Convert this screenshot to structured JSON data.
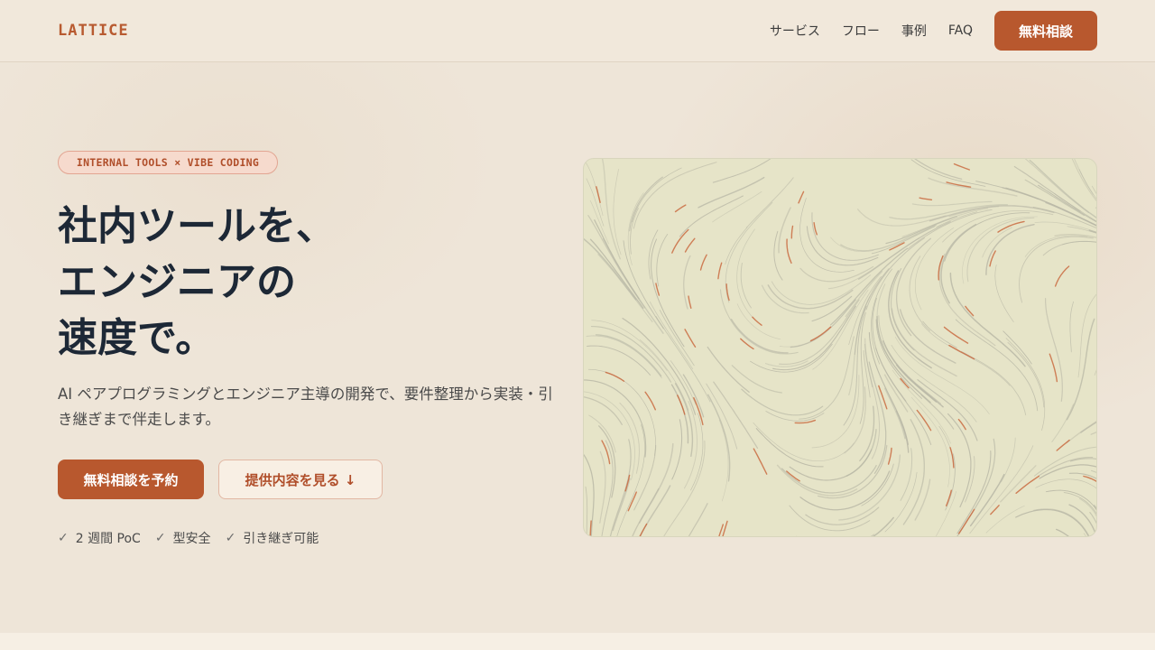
{
  "brand": {
    "logo": "LATTICE"
  },
  "nav": {
    "items": [
      "サービス",
      "フロー",
      "事例",
      "FAQ"
    ],
    "cta": "無料相談"
  },
  "hero": {
    "badge": "INTERNAL TOOLS × VIBE CODING",
    "title_lines": [
      "社内ツールを、",
      "エンジニアの",
      "速度で。"
    ],
    "subtitle": "AI ペアプログラミングとエンジニア主導の開発で、要件整理から実装・引き継ぎまで伴走します。",
    "primary_cta": "無料相談を予約",
    "secondary_cta": "提供内容を見る ↓",
    "checks": [
      "2 週間 PoC",
      "型安全",
      "引き継ぎ可能"
    ]
  },
  "colors": {
    "accent": "#b8582e",
    "background": "#efe6da",
    "visual_bg": "#e6e4c8",
    "stroke_gray": "#b9b8a6",
    "stroke_orange": "#c8643a"
  },
  "visual": {
    "icon": "flow-field-lines"
  }
}
